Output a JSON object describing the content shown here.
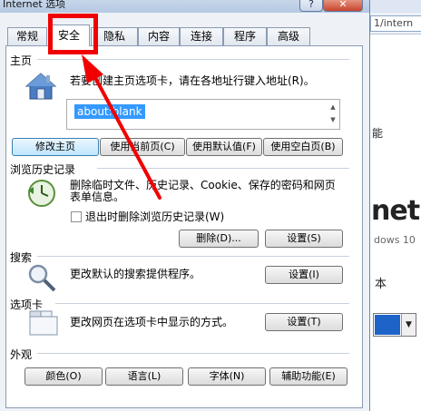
{
  "dialog": {
    "title": "Internet 选项",
    "help_glyph": "?",
    "close_glyph": "✕"
  },
  "tabs": [
    {
      "label": "常规",
      "active": false
    },
    {
      "label": "安全",
      "active": true
    },
    {
      "label": "隐私",
      "active": false
    },
    {
      "label": "内容",
      "active": false
    },
    {
      "label": "连接",
      "active": false
    },
    {
      "label": "程序",
      "active": false
    },
    {
      "label": "高级",
      "active": false
    }
  ],
  "homepage": {
    "label": "主页",
    "description": "若要创建主页选项卡，请在各地址行键入地址(R)。",
    "value": "about:blank",
    "buttons": {
      "change": "修改主页",
      "use_current": "使用当前页(C)",
      "use_default": "使用默认值(F)",
      "use_blank": "使用空白页(B)"
    }
  },
  "history": {
    "label": "浏览历史记录",
    "description_line1": "删除临时文件、历史记录、Cookie、保存的密码和网页",
    "description_line2": "表单信息。",
    "checkbox_label": "退出时删除浏览历史记录(W)",
    "delete_button": "删除(D)...",
    "settings_button": "设置(S)"
  },
  "search": {
    "label": "搜索",
    "description": "更改默认的搜索提供程序。",
    "settings_button": "设置(I)"
  },
  "tabs_section": {
    "label": "选项卡",
    "description": "更改网页在选项卡中显示的方式。",
    "settings_button": "设置(T)"
  },
  "appearance": {
    "label": "外观",
    "buttons": {
      "colors": "颜色(O)",
      "languages": "语言(L)",
      "fonts": "字体(N)",
      "accessibility": "辅助功能(E)"
    }
  },
  "background_window": {
    "address_fragment": "1/intern",
    "text_neng": "能",
    "text_net": "net",
    "text_win10": "dows 10",
    "text_ben": "本"
  },
  "colors": {
    "annotation": "#f00000",
    "selection": "#3399ff"
  }
}
